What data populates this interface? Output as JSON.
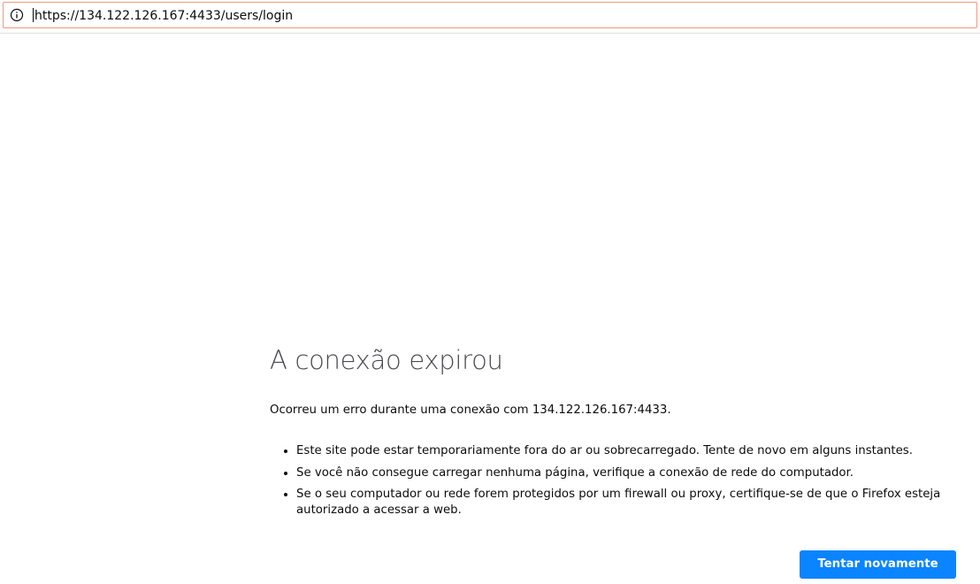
{
  "browser": {
    "url": "https://134.122.126.167:4433/users/login",
    "url_icon": "info-icon"
  },
  "error_page": {
    "title": "A conexão expirou",
    "description": "Ocorreu um erro durante uma conexão com 134.122.126.167:4433.",
    "suggestions": [
      "Este site pode estar temporariamente fora do ar ou sobrecarregado. Tente de novo em alguns instantes.",
      "Se você não consegue carregar nenhuma página, verifique a conexão de rede do computador.",
      "Se o seu computador ou rede forem protegidos por um firewall ou proxy, certifique-se de que o Firefox esteja autorizado a acessar a web."
    ],
    "retry_label": "Tentar novamente"
  },
  "colors": {
    "accent": "#0a84ff",
    "urlbar_border": "#f0997b",
    "title": "#4a4a4f"
  }
}
